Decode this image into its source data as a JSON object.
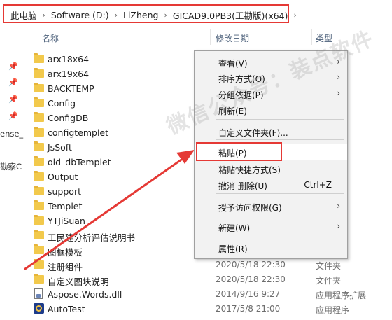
{
  "breadcrumb": {
    "items": [
      "此电脑",
      "Software (D:)",
      "LiZheng",
      "GICAD9.0PB3(工勘版)(x64)"
    ],
    "separator": "›",
    "highlight_color": "#e53935"
  },
  "nav": {
    "cut_labels": [
      "ense_",
      "勘察C"
    ]
  },
  "columns": {
    "name": "名称",
    "date": "修改日期",
    "type": "类型"
  },
  "files": [
    {
      "name": "arx18x64",
      "kind": "folder",
      "date": "",
      "type": ""
    },
    {
      "name": "arx19x64",
      "kind": "folder",
      "date": "",
      "type": ""
    },
    {
      "name": "BACKTEMP",
      "kind": "folder",
      "date": "",
      "type": ""
    },
    {
      "name": "Config",
      "kind": "folder",
      "date": "",
      "type": ""
    },
    {
      "name": "ConfigDB",
      "kind": "folder",
      "date": "",
      "type": ""
    },
    {
      "name": "configtemplet",
      "kind": "folder",
      "date": "",
      "type": ""
    },
    {
      "name": "JsSoft",
      "kind": "folder",
      "date": "",
      "type": ""
    },
    {
      "name": "old_dbTemplet",
      "kind": "folder",
      "date": "",
      "type": ""
    },
    {
      "name": "Output",
      "kind": "folder",
      "date": "",
      "type": ""
    },
    {
      "name": "support",
      "kind": "folder",
      "date": "",
      "type": ""
    },
    {
      "name": "Templet",
      "kind": "folder",
      "date": "",
      "type": ""
    },
    {
      "name": "YTJiSuan",
      "kind": "folder",
      "date": "",
      "type": ""
    },
    {
      "name": "工民建分析评估说明书",
      "kind": "folder",
      "date": "",
      "type": ""
    },
    {
      "name": "图框模板",
      "kind": "folder",
      "date": "",
      "type": ""
    },
    {
      "name": "注册组件",
      "kind": "folder",
      "date": "2020/5/18 22:30",
      "type": "文件夹"
    },
    {
      "name": "自定义图块说明",
      "kind": "folder",
      "date": "2020/5/18 22:30",
      "type": "文件夹"
    },
    {
      "name": "Aspose.Words.dll",
      "kind": "dll",
      "date": "2014/9/16 9:27",
      "type": "应用程序扩展"
    },
    {
      "name": "AutoTest",
      "kind": "exe",
      "date": "2017/5/8 21:00",
      "type": "应用程序"
    }
  ],
  "context_menu": {
    "items": [
      {
        "label": "查看(V)",
        "submenu": true,
        "shortcut": ""
      },
      {
        "label": "排序方式(O)",
        "submenu": true,
        "shortcut": ""
      },
      {
        "label": "分组依据(P)",
        "submenu": true,
        "shortcut": ""
      },
      {
        "label": "刷新(E)",
        "submenu": false,
        "shortcut": ""
      },
      {
        "label": "自定义文件夹(F)...",
        "submenu": false,
        "shortcut": ""
      },
      {
        "label": "粘贴(P)",
        "submenu": false,
        "shortcut": "",
        "highlighted": true
      },
      {
        "label": "粘贴快捷方式(S)",
        "submenu": false,
        "shortcut": ""
      },
      {
        "label": "撤消 删除(U)",
        "submenu": false,
        "shortcut": "Ctrl+Z"
      },
      {
        "label": "授予访问权限(G)",
        "submenu": true,
        "shortcut": ""
      },
      {
        "label": "新建(W)",
        "submenu": true,
        "shortcut": ""
      },
      {
        "label": "属性(R)",
        "submenu": false,
        "shortcut": ""
      }
    ],
    "submenu_arrow": "›"
  },
  "watermark": "微信公众号：装点软件",
  "annotation_color": "#e53935"
}
